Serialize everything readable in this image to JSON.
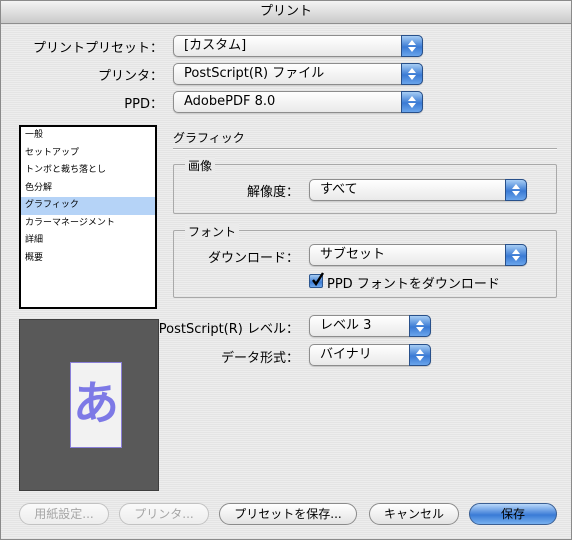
{
  "window": {
    "title": "プリント"
  },
  "top_fields": {
    "preset": {
      "label": "プリントプリセット：",
      "value": "[カスタム]"
    },
    "printer": {
      "label": "プリンタ：",
      "value": "PostScript(R) ファイル"
    },
    "ppd": {
      "label": "PPD：",
      "value": "AdobePDF 8.0"
    }
  },
  "sidebar": {
    "items": [
      "一般",
      "セットアップ",
      "トンボと裁ち落とし",
      "色分解",
      "グラフィック",
      "カラーマネージメント",
      "詳細",
      "概要"
    ],
    "selected": "グラフィック"
  },
  "preview": {
    "glyph": "あ"
  },
  "panel": {
    "title": "グラフィック",
    "image_group": {
      "title": "画像",
      "resolution_label": "解像度：",
      "resolution_value": "すべて"
    },
    "font_group": {
      "title": "フォント",
      "download_label": "ダウンロード：",
      "download_value": "サブセット",
      "ppd_font_checkbox_label": "PPD フォントをダウンロード",
      "ppd_font_checked": true
    },
    "ps_level_label": "PostScript(R) レベル：",
    "ps_level_value": "レベル 3",
    "data_format_label": "データ形式：",
    "data_format_value": "バイナリ"
  },
  "buttons": {
    "page_setup": "用紙設定...",
    "printer": "プリンタ...",
    "save_preset": "プリセットを保存...",
    "cancel": "キャンセル",
    "save": "保存"
  },
  "colors": {
    "accent": "#3a7bd6",
    "selection": "#b5d3f7",
    "preview_bg": "#595959",
    "glyph": "#7d79e6"
  }
}
